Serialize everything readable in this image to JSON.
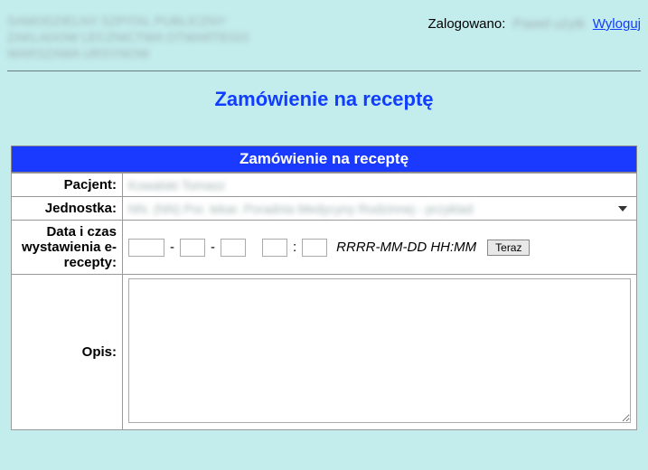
{
  "header": {
    "org_lines": "SAMODZIELNY SZPITAL PUBLICZNY\nZAKLADOW LECZNICTWA OTWARTEGO\nWARSZAWA URSYNOW",
    "logged_label": "Zalogowano:",
    "logged_user": "Paweł użytk",
    "logout_label": "Wyloguj"
  },
  "title": "Zamówienie na receptę",
  "section_header": "Zamówienie na receptę",
  "labels": {
    "patient": "Pacjent:",
    "unit": "Jednostka:",
    "date": "Data i czas wystawienia e-recepty:",
    "opis": "Opis:"
  },
  "values": {
    "patient": "Kowalski Tomasz",
    "unit": "NN. (NN) Por. lekar. Poradnia Medycyny Rodzinnej - przyklad"
  },
  "date_inputs": {
    "year": "",
    "month": "",
    "day": "",
    "hour": "",
    "minute": "",
    "format_hint": "RRRR-MM-DD HH:MM",
    "now_button": "Teraz"
  },
  "opis_value": ""
}
